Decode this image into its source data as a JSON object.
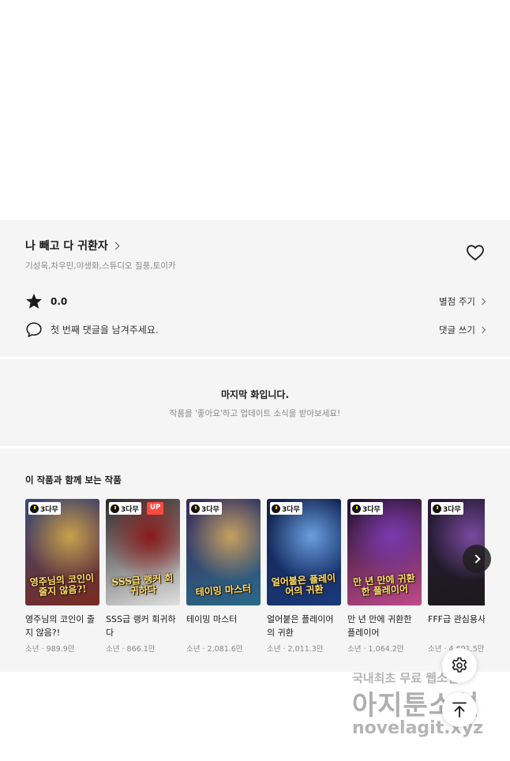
{
  "work": {
    "title": "나 빼고 다 귀환자",
    "authors": "기성욱,차우민,야생화,스튜디오 질풍,토이카",
    "score": "0.0",
    "rate_label": "별점 주기",
    "comment_prompt": "첫 번째 댓글을 남겨주세요.",
    "comment_label": "댓글 쓰기"
  },
  "last_episode": {
    "title": "마지막 화입니다.",
    "subtitle": "작품을 '좋아요'하고 업데이트 소식을 받아보세요!"
  },
  "recommendations": {
    "heading": "이 작품과 함께 보는 작품",
    "items": [
      {
        "badge": "3다무",
        "up": "",
        "cover_text": "영주님의 코인이 줄지 않음?!",
        "title": "영주님의 코인이 줄지 않음?!",
        "meta": "소년 · 989.9만",
        "colors": [
          "#3a4a7a",
          "#c9a24a",
          "#7a2a20"
        ]
      },
      {
        "badge": "3다무",
        "up": "UP",
        "cover_text": "SSS급 랭커 회귀하다",
        "title": "SSS급 랭커 회귀하다",
        "meta": "소년 · 866.1만",
        "colors": [
          "#2a2a2a",
          "#8a1a1a",
          "#e0e0e0"
        ]
      },
      {
        "badge": "3다무",
        "up": "",
        "cover_text": "테이밍 마스터",
        "title": "테이밍 마스터",
        "meta": "소년 · 2,081.6만",
        "colors": [
          "#3a2a5a",
          "#c8a060",
          "#2a6a8a"
        ]
      },
      {
        "badge": "3다무",
        "up": "",
        "cover_text": "얼어붙은 플레이어의 귀환",
        "title": "얼어붙은 플레이어의 귀환",
        "meta": "소년 · 2,011.3만",
        "colors": [
          "#10204a",
          "#6aa0e0",
          "#1a3a7a"
        ]
      },
      {
        "badge": "3다무",
        "up": "",
        "cover_text": "만 년 만에 귀환한 플레이어",
        "title": "만 년 만에 귀환한 플레이어",
        "meta": "소년 · 1,064.2만",
        "colors": [
          "#1a1030",
          "#7a3ab0",
          "#c04a8a"
        ]
      },
      {
        "badge": "3다무",
        "up": "",
        "cover_text": "",
        "title": "FFF급 관심용사",
        "meta": "소년 · 4,691.5만",
        "colors": [
          "#2a1a3a",
          "#7a4aa0",
          "#1a1a1a"
        ]
      }
    ]
  },
  "watermark": {
    "line1": "국내최초 무료 웹소설",
    "line2": "아지툰소설",
    "line3": "novelagit.xyz"
  },
  "icons": {
    "heart": "heart-outline-icon",
    "star": "star-icon",
    "comment": "speech-bubble-icon",
    "next": "chevron-right-icon",
    "settings": "gear-icon",
    "top": "arrow-up-icon"
  }
}
